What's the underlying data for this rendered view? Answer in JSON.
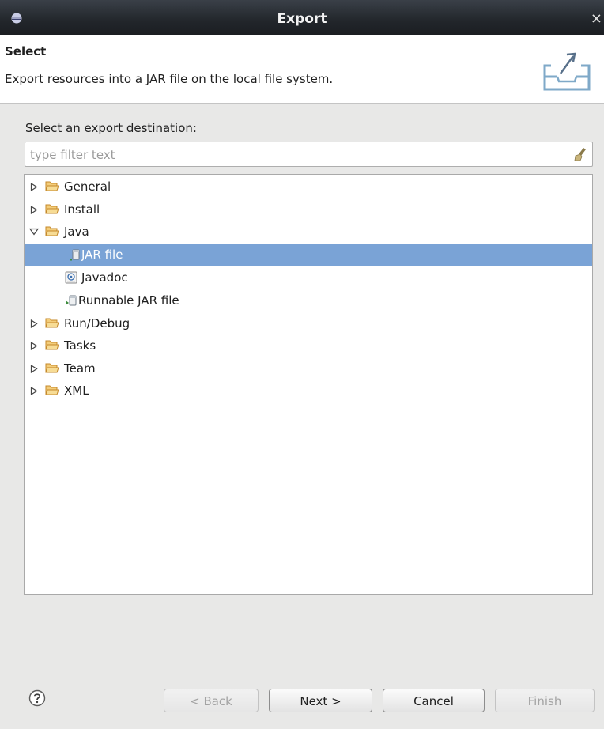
{
  "window": {
    "title": "Export",
    "close_glyph": "×"
  },
  "header": {
    "title": "Select",
    "description": "Export resources into a JAR file on the local file system."
  },
  "destination": {
    "label": "Select an export destination:",
    "filter_placeholder": "type filter text",
    "filter_value": ""
  },
  "tree": {
    "items": [
      {
        "label": "General",
        "expanded": false
      },
      {
        "label": "Install",
        "expanded": false
      },
      {
        "label": "Java",
        "expanded": true,
        "children": [
          {
            "label": "JAR file",
            "selected": true
          },
          {
            "label": "Javadoc"
          },
          {
            "label": "Runnable JAR file"
          }
        ]
      },
      {
        "label": "Run/Debug",
        "expanded": false
      },
      {
        "label": "Tasks",
        "expanded": false
      },
      {
        "label": "Team",
        "expanded": false
      },
      {
        "label": "XML",
        "expanded": false
      }
    ]
  },
  "buttons": {
    "back": "< Back",
    "next": "Next >",
    "cancel": "Cancel",
    "finish": "Finish"
  },
  "colors": {
    "selection": "#7aa3d6",
    "folder": "#e0a43a",
    "titlebar": "#22262b"
  }
}
